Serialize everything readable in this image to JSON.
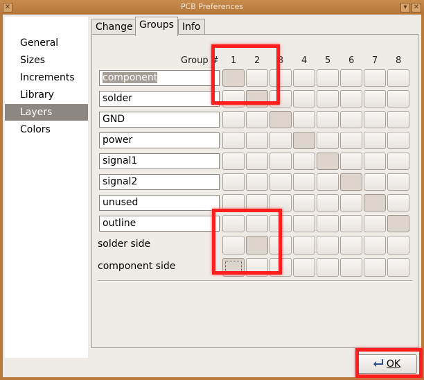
{
  "window": {
    "title": "PCB Preferences",
    "menu_glyph": "✕",
    "minimize_glyph": "▾",
    "maximize_glyph": "▴",
    "close_glyph": "✕"
  },
  "sidebar": {
    "items": [
      {
        "label": "General",
        "selected": false
      },
      {
        "label": "Sizes",
        "selected": false
      },
      {
        "label": "Increments",
        "selected": false
      },
      {
        "label": "Library",
        "selected": false
      },
      {
        "label": "Layers",
        "selected": true
      },
      {
        "label": "Colors",
        "selected": false
      }
    ]
  },
  "tabs": [
    {
      "label": "Change",
      "active": false
    },
    {
      "label": "Groups",
      "active": true
    },
    {
      "label": "Info",
      "active": false
    }
  ],
  "groups": {
    "header_label": "Group #",
    "columns": [
      "1",
      "2",
      "3",
      "4",
      "5",
      "6",
      "7",
      "8"
    ],
    "layers": [
      {
        "name": "component",
        "selected_text": true,
        "group": 1
      },
      {
        "name": "solder",
        "group": 2
      },
      {
        "name": "GND",
        "group": 3
      },
      {
        "name": "power",
        "group": 4
      },
      {
        "name": "signal1",
        "group": 5
      },
      {
        "name": "signal2",
        "group": 6
      },
      {
        "name": "unused",
        "group": 7
      },
      {
        "name": "outline",
        "group": 8
      }
    ],
    "sides": [
      {
        "label": "solder side",
        "group": 2
      },
      {
        "label": "component side",
        "group": 1,
        "focused": true
      }
    ]
  },
  "buttons": {
    "ok_label": "OK",
    "ok_icon": "enter-key-icon"
  },
  "colors": {
    "titlebar": "#b8793a",
    "selected_item": "#8c8780",
    "active_cell": "#ddd5cb",
    "highlight": "#ff1e1e"
  }
}
